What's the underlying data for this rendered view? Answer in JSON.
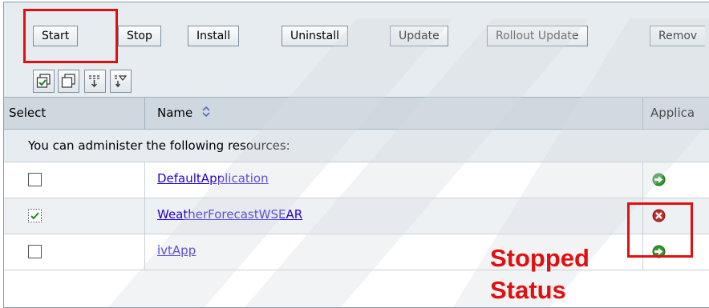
{
  "toolbar": {
    "buttons": [
      "Start",
      "Stop",
      "Install",
      "Uninstall",
      "Update",
      "Rollout Update",
      "Remov"
    ],
    "icons": [
      "select-all-icon",
      "deselect-all-icon",
      "expand-filter-icon",
      "filter-icon"
    ]
  },
  "table": {
    "columns": [
      "Select",
      "Name",
      "Applica"
    ],
    "resources_message": "You can administer the following resources:",
    "rows": [
      {
        "name": "DefaultApplication",
        "checked": false,
        "status": "running"
      },
      {
        "name": "WeatherForecastWSEAR",
        "checked": true,
        "status": "stopped"
      },
      {
        "name": "ivtApp",
        "checked": false,
        "status": "running"
      }
    ]
  },
  "annotation": {
    "line1": "Stopped",
    "line2": "Status"
  },
  "colors": {
    "highlight": "#e01010",
    "link": "#2200cc",
    "running": "#2e9a2e",
    "stopped": "#c0282a"
  }
}
